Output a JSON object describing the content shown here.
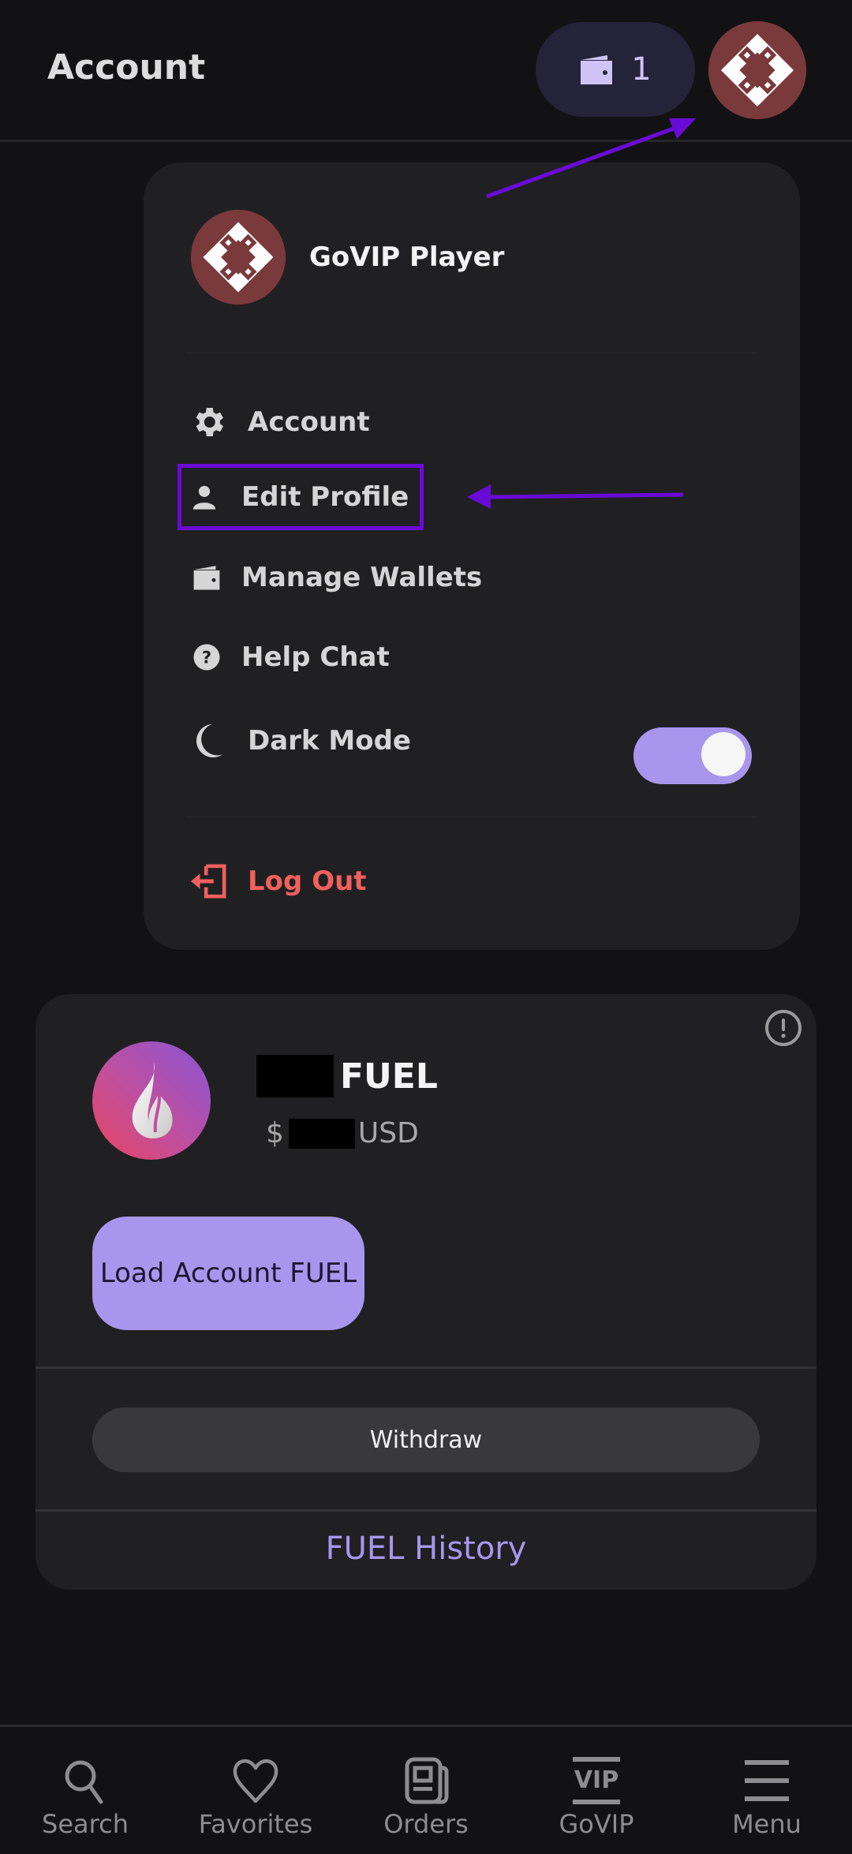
{
  "header": {
    "title": "Account",
    "wallet_count": "1"
  },
  "dropdown": {
    "user_name": "GoVIP Player",
    "items": [
      {
        "label": "Account",
        "icon": "gear-icon"
      },
      {
        "label": "Edit Profile",
        "icon": "person-icon"
      },
      {
        "label": "Manage Wallets",
        "icon": "wallet-icon"
      },
      {
        "label": "Help Chat",
        "icon": "help-circle-icon"
      },
      {
        "label": "Dark Mode",
        "icon": "moon-icon"
      }
    ],
    "dark_mode_enabled": true,
    "logout_label": "Log Out"
  },
  "fuel_card": {
    "amount_redacted": true,
    "unit": "FUEL",
    "usd_prefix": "$",
    "usd_suffix": "USD",
    "load_button": "Load Account FUEL",
    "withdraw_button": "Withdraw",
    "history_link": "FUEL History"
  },
  "bottom_nav": [
    {
      "label": "Search",
      "icon": "search-icon"
    },
    {
      "label": "Favorites",
      "icon": "heart-icon"
    },
    {
      "label": "Orders",
      "icon": "newspaper-icon"
    },
    {
      "label": "GoVIP",
      "icon": "vip-icon",
      "icon_text": "VIP"
    },
    {
      "label": "Menu",
      "icon": "hamburger-icon"
    }
  ],
  "colors": {
    "accent": "#a896ee",
    "danger": "#f0605e",
    "annotation": "#6a0ad6",
    "avatar_bg": "#7a3a3b",
    "background": "#121214",
    "card": "#202022"
  }
}
